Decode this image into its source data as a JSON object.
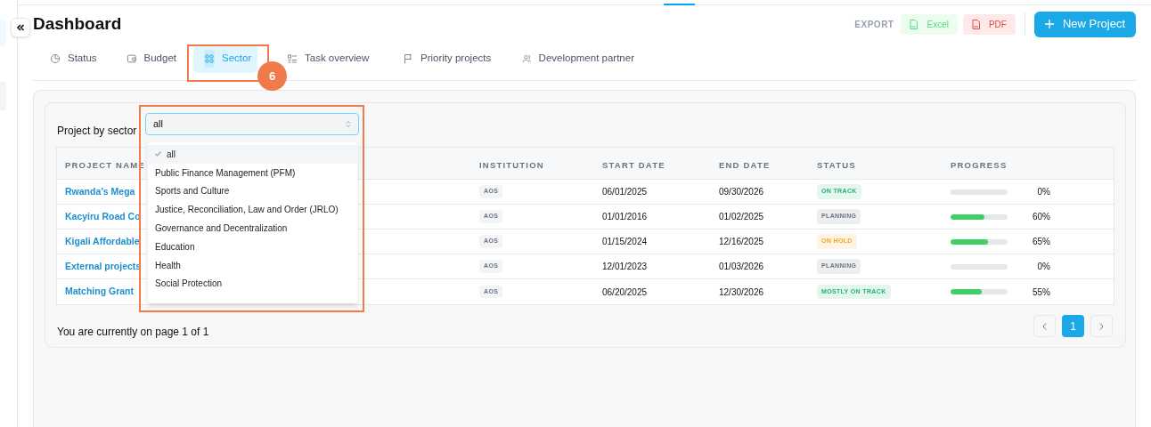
{
  "header": {
    "title": "Dashboard",
    "export_label": "EXPORT",
    "export_buttons": [
      {
        "kind": "excel",
        "label": "Excel"
      },
      {
        "kind": "pdf",
        "label": "PDF"
      }
    ],
    "new_button": "New Project"
  },
  "tabs": [
    {
      "label": "Status",
      "selected": false
    },
    {
      "label": "Budget",
      "selected": false
    },
    {
      "label": "Sector",
      "selected": true
    },
    {
      "label": "Task overview",
      "selected": false
    },
    {
      "label": "Priority projects",
      "selected": false
    },
    {
      "label": "Development partner",
      "selected": false
    }
  ],
  "step_badge": "6",
  "filter": {
    "label": "Project by sector",
    "value": "all",
    "options": [
      {
        "label": "all",
        "selected": true
      },
      {
        "label": "Public Finance Management (PFM)",
        "selected": false
      },
      {
        "label": "Sports and Culture",
        "selected": false
      },
      {
        "label": "Justice, Reconciliation, Law and Order (JRLO)",
        "selected": false
      },
      {
        "label": "Governance and Decentralization",
        "selected": false
      },
      {
        "label": "Education",
        "selected": false
      },
      {
        "label": "Health",
        "selected": false
      },
      {
        "label": "Social Protection",
        "selected": false
      }
    ]
  },
  "table": {
    "columns": [
      "PROJECT NAME",
      "INSTITUTION",
      "START DATE",
      "END DATE",
      "STATUS",
      "PROGRESS"
    ],
    "rows": [
      {
        "name": "Rwanda’s Mega",
        "institution": "AOS",
        "start": "06/01/2025",
        "end": "09/30/2026",
        "status": "ON TRACK",
        "color": "#22b573",
        "level": 0,
        "percent": "0%"
      },
      {
        "name": "Kacyiru Road Co",
        "institution": "AOS",
        "start": "01/01/2016",
        "end": "01/02/2025",
        "status": "PLANNING",
        "color": "#6b7280",
        "level": 0.6,
        "percent": "60%"
      },
      {
        "name": "Kigali Affordable",
        "institution": "AOS",
        "start": "01/15/2024",
        "end": "12/16/2025",
        "status": "ON HOLD",
        "color": "#f5a623",
        "level": 0.65,
        "percent": "65%"
      },
      {
        "name": "External projects",
        "institution": "AOS",
        "start": "12/01/2023",
        "end": "01/03/2026",
        "status": "PLANNING",
        "color": "#6b7280",
        "level": 0,
        "percent": "0%"
      },
      {
        "name": "Matching Grant",
        "institution": "AOS",
        "start": "06/20/2025",
        "end": "12/30/2026",
        "status": "MOSTLY ON TRACK",
        "color": "#22b573",
        "level": 0.55,
        "percent": "55%"
      }
    ]
  },
  "pagination": {
    "text": "You are currently on page 1 of 1",
    "pages": [
      {
        "label": "1",
        "selected": true
      }
    ]
  }
}
